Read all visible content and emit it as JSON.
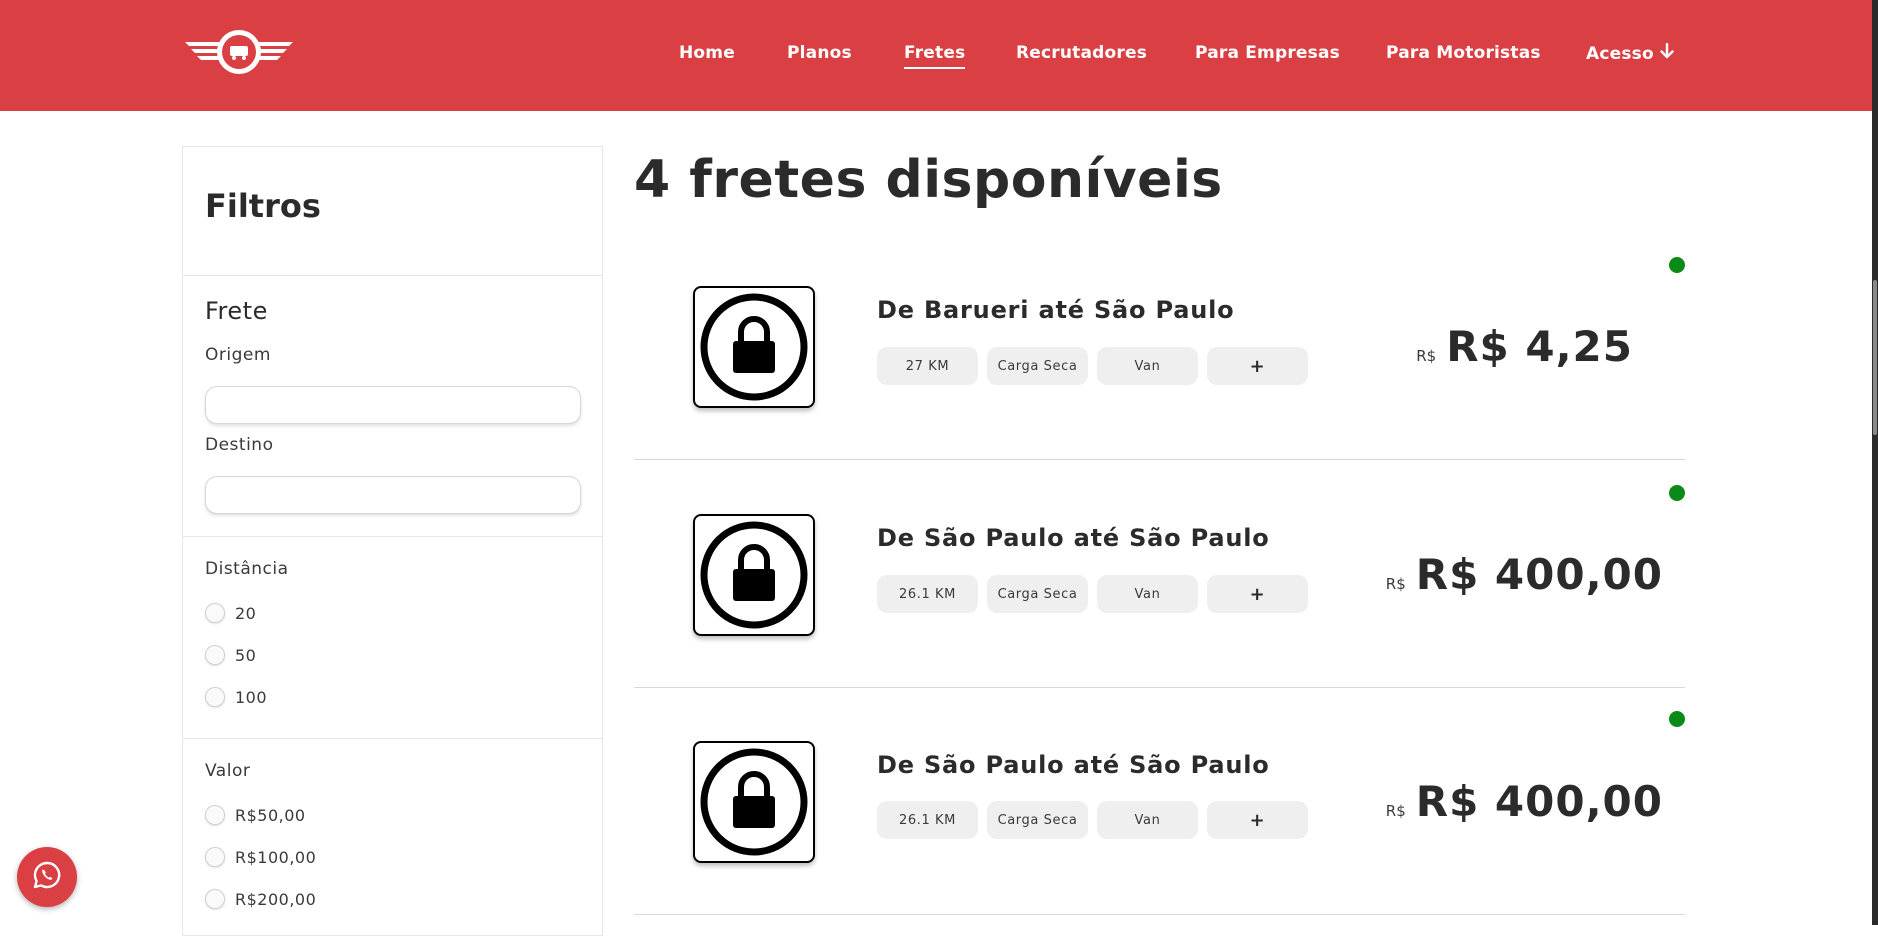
{
  "header": {
    "nav": [
      {
        "label": "Home",
        "active": false
      },
      {
        "label": "Planos",
        "active": false
      },
      {
        "label": "Fretes",
        "active": true
      },
      {
        "label": "Recrutadores",
        "active": false
      },
      {
        "label": "Para Empresas",
        "active": false
      },
      {
        "label": "Para Motoristas",
        "active": false
      },
      {
        "label": "Acesso",
        "active": false,
        "icon": "arrow-down-icon"
      }
    ],
    "brand_color": "#da4043"
  },
  "sidebar": {
    "title": "Filtros",
    "frete": {
      "title": "Frete",
      "origem_label": "Origem",
      "origem_value": "",
      "destino_label": "Destino",
      "destino_value": ""
    },
    "distancia": {
      "title": "Distância",
      "options": [
        "20",
        "50",
        "100"
      ]
    },
    "valor": {
      "title": "Valor",
      "options": [
        "R$50,00",
        "R$100,00",
        "R$200,00"
      ]
    }
  },
  "main": {
    "title": "4 fretes disponíveis",
    "cards": [
      {
        "route": "De Barueri até São Paulo",
        "distance": "27 KM",
        "cargo": "Carga Seca",
        "vehicle": "Van",
        "more": "+",
        "currency": "R$",
        "price": "R$ 4,25",
        "status_color": "#0a8a16"
      },
      {
        "route": "De São Paulo até São Paulo",
        "distance": "26.1 KM",
        "cargo": "Carga Seca",
        "vehicle": "Van",
        "more": "+",
        "currency": "R$",
        "price": "R$ 400,00",
        "status_color": "#0a8a16"
      },
      {
        "route": "De São Paulo até São Paulo",
        "distance": "26.1 KM",
        "cargo": "Carga Seca",
        "vehicle": "Van",
        "more": "+",
        "currency": "R$",
        "price": "R$ 400,00",
        "status_color": "#0a8a16"
      }
    ]
  },
  "whatsapp": {
    "icon": "whatsapp-icon"
  }
}
